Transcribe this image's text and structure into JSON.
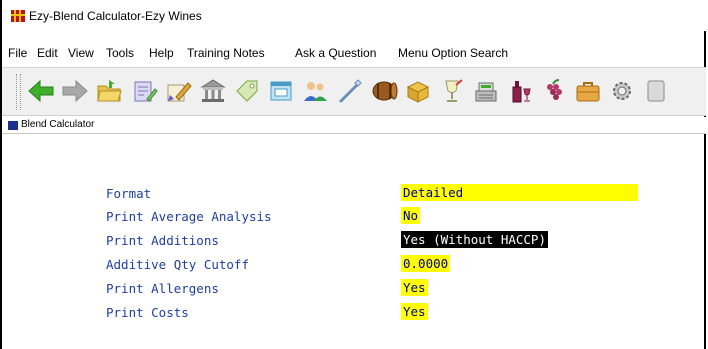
{
  "window": {
    "title": "Ezy-Blend Calculator-Ezy Wines"
  },
  "menu": [
    {
      "label": "File"
    },
    {
      "label": "Edit"
    },
    {
      "label": "View"
    },
    {
      "label": "Tools"
    },
    {
      "label": "Help"
    },
    {
      "label": "Training Notes"
    },
    {
      "label": "Ask a Question"
    },
    {
      "label": "Menu Option Search"
    }
  ],
  "toolbar": {
    "buttons": [
      {
        "icon": "back-arrow-icon"
      },
      {
        "icon": "forward-arrow-icon"
      },
      {
        "icon": "open-folder-icon"
      },
      {
        "icon": "edit-document-icon"
      },
      {
        "icon": "pen-paper-icon"
      },
      {
        "icon": "building-icon"
      },
      {
        "icon": "tag-icon"
      },
      {
        "icon": "window-icon"
      },
      {
        "icon": "users-icon"
      },
      {
        "icon": "wand-icon"
      },
      {
        "icon": "barrel-icon"
      },
      {
        "icon": "box-icon"
      },
      {
        "icon": "glass-icon"
      },
      {
        "icon": "cash-register-icon"
      },
      {
        "icon": "wine-bottle-icon"
      },
      {
        "icon": "grapes-icon"
      },
      {
        "icon": "briefcase-icon"
      },
      {
        "icon": "gear-icon"
      },
      {
        "icon": "panel-icon"
      }
    ]
  },
  "subwindow": {
    "title": "Blend Calculator"
  },
  "form": {
    "fields": [
      {
        "label": "Format",
        "value": "Detailed",
        "state": "highlight"
      },
      {
        "label": "Print Average Analysis",
        "value": "No",
        "state": "highlight"
      },
      {
        "label": "Print Additions",
        "value": "Yes (Without HACCP)",
        "state": "selected"
      },
      {
        "label": "Additive Qty Cutoff",
        "value": "0.0000",
        "state": "highlight"
      },
      {
        "label": "Print Allergens",
        "value": "Yes",
        "state": "highlight"
      },
      {
        "label": "Print Costs",
        "value": "Yes",
        "state": "highlight"
      }
    ]
  },
  "colors": {
    "label": "#1e3ea0",
    "field_highlight": "#ffff00",
    "field_selected": "#000000"
  }
}
